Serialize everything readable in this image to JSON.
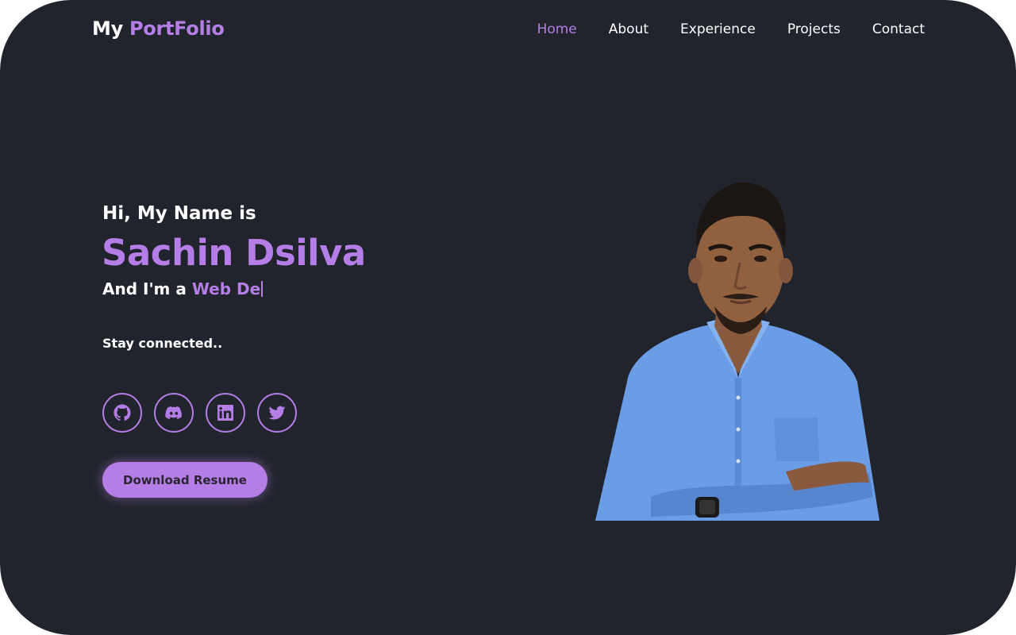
{
  "header": {
    "logo_prefix": "My",
    "logo_accent": "PortFolio",
    "nav": [
      {
        "label": "Home",
        "active": true
      },
      {
        "label": "About",
        "active": false
      },
      {
        "label": "Experience",
        "active": false
      },
      {
        "label": "Projects",
        "active": false
      },
      {
        "label": "Contact",
        "active": false
      }
    ]
  },
  "hero": {
    "greeting": "Hi, My Name is",
    "name": "Sachin Dsilva",
    "role_prefix": "And I'm a",
    "role_typed": "Web De",
    "stay": "Stay connected..",
    "socials": [
      {
        "icon": "github-icon"
      },
      {
        "icon": "discord-icon"
      },
      {
        "icon": "linkedin-icon"
      },
      {
        "icon": "twitter-icon"
      }
    ],
    "resume_label": "Download Resume"
  },
  "colors": {
    "background": "#21242d",
    "accent": "#b57ee6",
    "text": "#ffffff"
  }
}
